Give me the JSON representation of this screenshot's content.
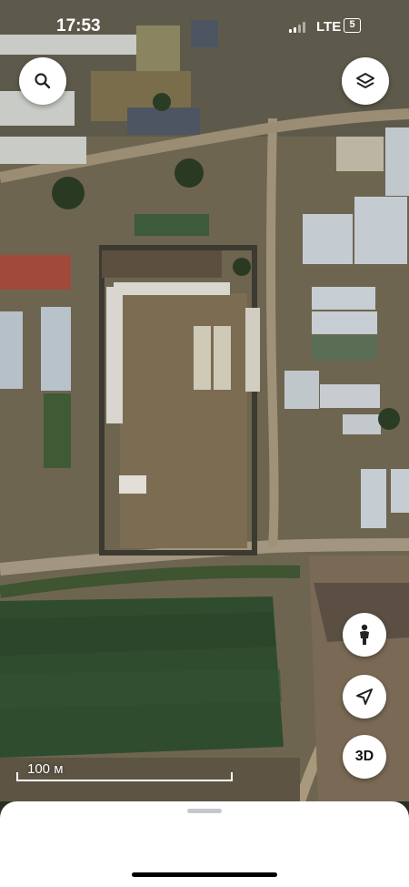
{
  "status_bar": {
    "time": "17:53",
    "network": "LTE",
    "battery": "5"
  },
  "map": {
    "type": "satellite",
    "scale_label": "100 м",
    "colors": {
      "field": "#2d4a2c",
      "soil": "#6f6550",
      "roof": "#c9ccc6",
      "road": "#9c8f78"
    }
  },
  "controls": {
    "search": {
      "icon": "search-icon"
    },
    "layers": {
      "icon": "layers-icon"
    },
    "street_view": {
      "icon": "pegman-icon"
    },
    "my_location": {
      "icon": "navigation-arrow-icon"
    },
    "view_3d": {
      "label": "3D"
    }
  },
  "bottom_sheet": {
    "handle": "drag-handle"
  }
}
